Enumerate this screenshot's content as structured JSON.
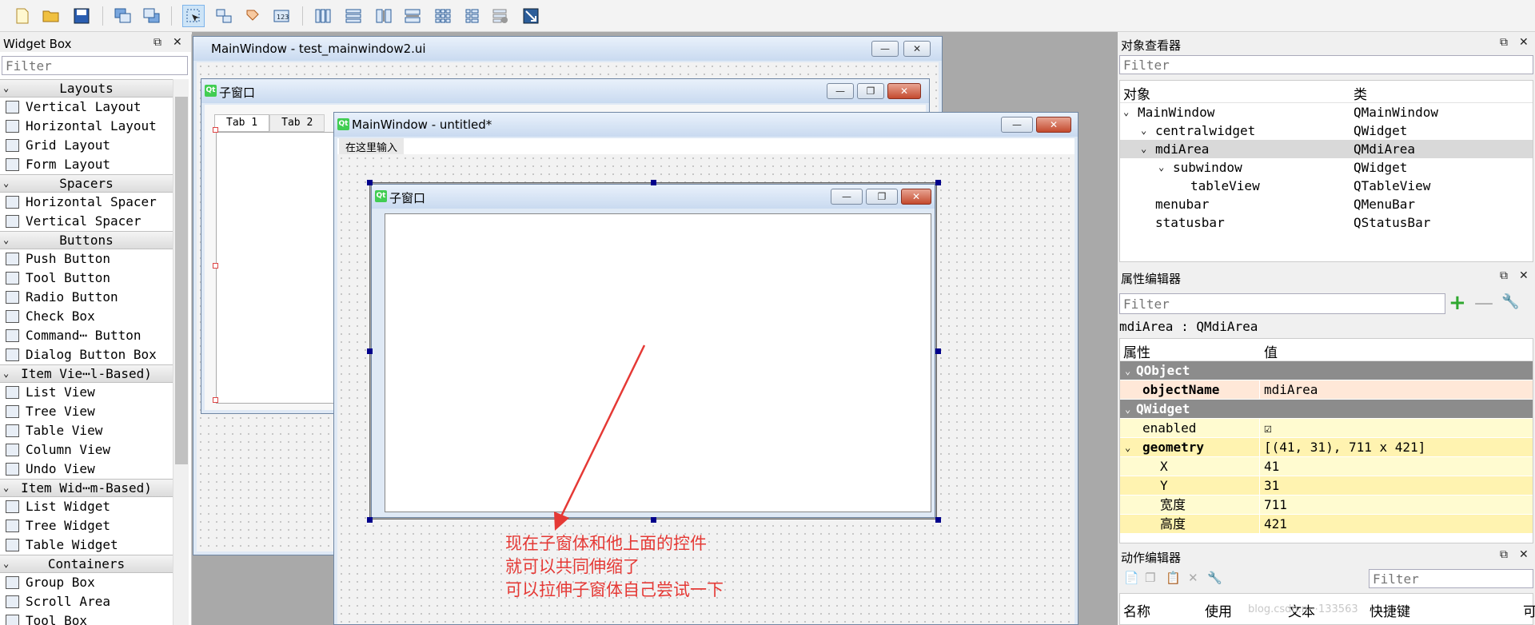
{
  "toolbar": {
    "buttons": [
      "new-file-icon",
      "open-folder-icon",
      "save-icon",
      "send-to-back-icon",
      "bring-to-front-icon",
      "edit-widgets-icon",
      "edit-signals-slots-icon",
      "edit-buddies-icon",
      "edit-tab-order-icon",
      "layout-horizontal-icon",
      "layout-vertical-icon",
      "layout-horizontal-splitter-icon",
      "layout-vertical-splitter-icon",
      "layout-grid-icon",
      "layout-form-icon",
      "break-layout-icon",
      "adjust-size-icon"
    ]
  },
  "widget_box": {
    "title": "Widget Box",
    "filter_placeholder": "Filter",
    "categories": [
      {
        "label": "Layouts",
        "items": [
          "Vertical Layout",
          "Horizontal Layout",
          "Grid Layout",
          "Form Layout"
        ]
      },
      {
        "label": "Spacers",
        "items": [
          "Horizontal Spacer",
          "Vertical Spacer"
        ]
      },
      {
        "label": "Buttons",
        "items": [
          "Push Button",
          "Tool Button",
          "Radio Button",
          "Check Box",
          "Command⋯ Button",
          "Dialog Button Box"
        ]
      },
      {
        "label": "Item Vie⋯l-Based)",
        "items": [
          "List View",
          "Tree View",
          "Table View",
          "Column View",
          "Undo View"
        ]
      },
      {
        "label": "Item Wid⋯m-Based)",
        "items": [
          "List Widget",
          "Tree Widget",
          "Table Widget"
        ]
      },
      {
        "label": "Containers",
        "items": [
          "Group Box",
          "Scroll Area",
          "Tool Box"
        ]
      }
    ]
  },
  "back_window": {
    "title": "MainWindow - test_mainwindow2.ui",
    "subwindow_title": "子窗口",
    "tabs": [
      "Tab 1",
      "Tab 2"
    ]
  },
  "front_window": {
    "title": "MainWindow - untitled*",
    "menu_placeholder": "在这里输入",
    "subwindow_title": "子窗口"
  },
  "annotation": {
    "lines": [
      "现在子窗体和他上面的控件",
      "就可以共同伸缩了",
      "可以拉伸子窗体自己尝试一下"
    ],
    "color": "#e53935"
  },
  "object_inspector": {
    "title": "对象查看器",
    "filter_placeholder": "Filter",
    "col_object": "对象",
    "col_class": "类",
    "rows": [
      {
        "name": "MainWindow",
        "cls": "QMainWindow"
      },
      {
        "name": "centralwidget",
        "cls": "QWidget"
      },
      {
        "name": "mdiArea",
        "cls": "QMdiArea"
      },
      {
        "name": "subwindow",
        "cls": "QWidget"
      },
      {
        "name": "tableView",
        "cls": "QTableView"
      },
      {
        "name": "menubar",
        "cls": "QMenuBar"
      },
      {
        "name": "statusbar",
        "cls": "QStatusBar"
      }
    ]
  },
  "property_editor": {
    "title": "属性编辑器",
    "filter_placeholder": "Filter",
    "context": "mdiArea : QMdiArea",
    "col_prop": "属性",
    "col_value": "值",
    "rows": [
      {
        "name": "QObject",
        "value": ""
      },
      {
        "name": "objectName",
        "value": "mdiArea"
      },
      {
        "name": "QWidget",
        "value": ""
      },
      {
        "name": "enabled",
        "value": "☑"
      },
      {
        "name": "geometry",
        "value": "[(41, 31), 711 x 421]"
      },
      {
        "name": "X",
        "value": "41"
      },
      {
        "name": "Y",
        "value": "31"
      },
      {
        "name": "宽度",
        "value": "711"
      },
      {
        "name": "高度",
        "value": "421"
      }
    ]
  },
  "action_editor": {
    "title": "动作编辑器",
    "filter_placeholder": "Filter",
    "columns": [
      "名称",
      "使用",
      "文本",
      "快捷键",
      "可"
    ],
    "watermark": "blog.csdn.n⋯133563"
  }
}
